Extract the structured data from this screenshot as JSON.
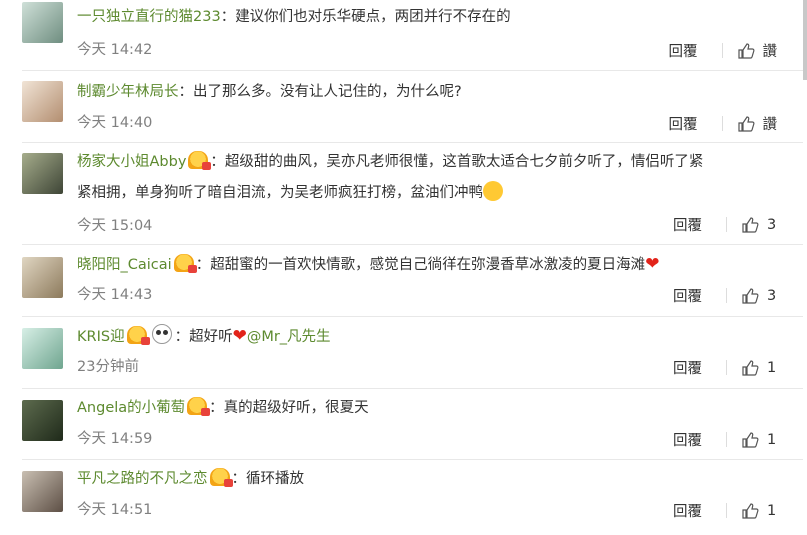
{
  "comments": [
    {
      "user": "一只独立直行的猫233",
      "badge": false,
      "text": "建议你们也对乐华硬点，两团并行不存在的",
      "line2": "",
      "time": "今天 14:42",
      "reply": "回覆",
      "likes": "讚",
      "avatar_color": "#9bb2a6"
    },
    {
      "user": "制霸少年林局长",
      "badge": false,
      "text": "出了那么多。没有让人记住的，为什么呢?",
      "line2": "",
      "time": "今天 14:40",
      "reply": "回覆",
      "likes": "讚",
      "avatar_color": "#c4a78c"
    },
    {
      "user": "杨家大小姐Abby",
      "badge": true,
      "text": "超级甜的曲风，吴亦凡老师很懂，这首歌太适合七夕前夕听了，情侣听了紧",
      "line2": "紧相拥，单身狗听了暗自泪流，为吴老师疯狂打榜，盆油们冲鸭",
      "time": "今天 15:04",
      "reply": "回覆",
      "likes": "3",
      "avatar_color": "#6e7a5c"
    },
    {
      "user": "晓阳阳_Caicai",
      "badge": true,
      "text": "超甜蜜的一首欢快情歌，感觉自己徜徉在弥漫香草冰激凌的夏日海滩",
      "line2": "",
      "time": "今天 14:43",
      "reply": "回覆",
      "likes": "3",
      "avatar_color": "#b9a98c"
    },
    {
      "user": "KRIS迎",
      "badge": true,
      "text": "超好听",
      "mention": "@Mr_凡先生",
      "line2": "",
      "time": "23分钟前",
      "reply": "回覆",
      "likes": "1",
      "avatar_color": "#86b7a6"
    },
    {
      "user": "Angela的小葡萄",
      "badge": true,
      "text": "真的超级好听，很夏天",
      "line2": "",
      "time": "今天 14:59",
      "reply": "回覆",
      "likes": "1",
      "avatar_color": "#3d4a36"
    },
    {
      "user": "平凡之路的不凡之恋",
      "badge": true,
      "text": "循环播放",
      "line2": "",
      "time": "今天 14:51",
      "reply": "回覆",
      "likes": "1",
      "avatar_color": "#8a7a6e"
    }
  ]
}
